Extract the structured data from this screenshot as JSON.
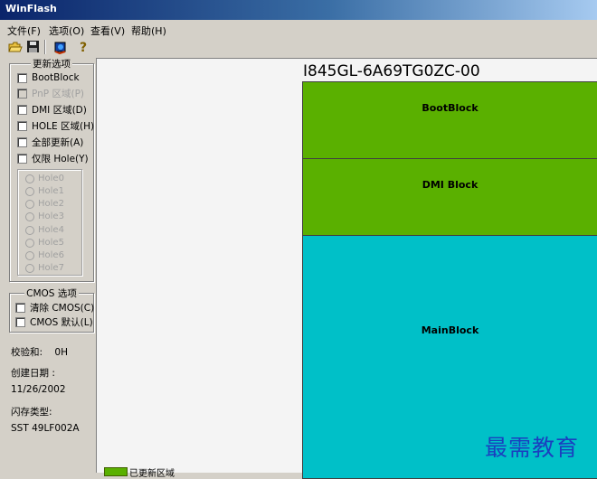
{
  "window": {
    "title": "WinFlash"
  },
  "menu": [
    "文件(F)",
    "选项(O)",
    "查看(V)",
    "帮助(H)"
  ],
  "toolbar": {
    "icons": [
      "open-folder-icon",
      "save-disk-icon",
      "flash-chip-icon",
      "help-question-icon"
    ]
  },
  "update_options": {
    "title": "更新选项",
    "items": [
      {
        "label": "BootBlock",
        "enabled": true
      },
      {
        "label": "PnP 区域(P)",
        "enabled": false
      },
      {
        "label": "DMI 区域(D)",
        "enabled": true
      },
      {
        "label": "HOLE 区域(H)",
        "enabled": true
      },
      {
        "label": "全部更新(A)",
        "enabled": true
      },
      {
        "label": "仅限 Hole(Y)",
        "enabled": true
      }
    ],
    "holes": [
      "Hole0",
      "Hole1",
      "Hole2",
      "Hole3",
      "Hole4",
      "Hole5",
      "Hole6",
      "Hole7"
    ]
  },
  "cmos_options": {
    "title": "CMOS 选项",
    "items": [
      "清除 CMOS(C)",
      "CMOS 默认(L)"
    ]
  },
  "info": {
    "checksum_label": "校验和:",
    "checksum_value": "0H",
    "build_date_label": "创建日期 :",
    "build_date_value": "11/26/2002",
    "flash_type_label": "闪存类型:",
    "flash_type_value": "SST 49LF002A"
  },
  "flash_map": {
    "chip_id": "I845GL-6A69TG0ZC-00",
    "blocks": [
      {
        "label": "BootBlock",
        "color": "#5ab000"
      },
      {
        "label": "DMI Block",
        "color": "#5ab000"
      },
      {
        "label": "MainBlock",
        "color": "#00c0c8"
      }
    ],
    "legend_label": "已更新区域"
  },
  "watermark": "最需教育"
}
